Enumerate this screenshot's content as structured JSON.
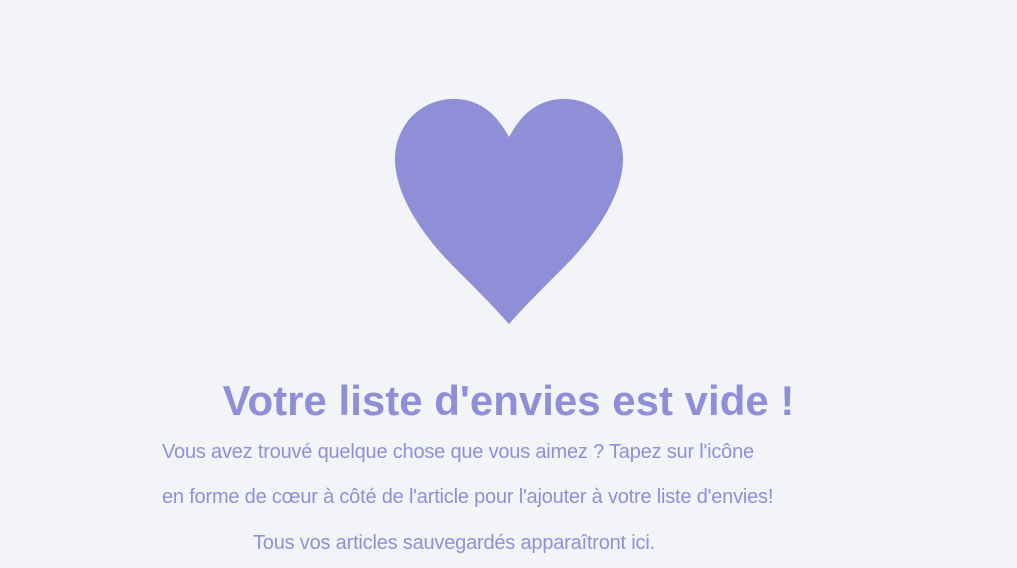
{
  "wishlist": {
    "icon": "heart-icon",
    "title": "Votre liste d'envies est vide !",
    "description_lines": [
      "Vous avez trouvé quelque chose que vous aimez ? Tapez sur l'icône",
      "en forme de cœur à côté de l'article pour l'ajouter à votre liste d'envies!",
      "Tous vos articles sauvegardés apparaîtront ici."
    ]
  },
  "colors": {
    "background": "#f3f4f8",
    "accent": "#8f8fd8"
  }
}
